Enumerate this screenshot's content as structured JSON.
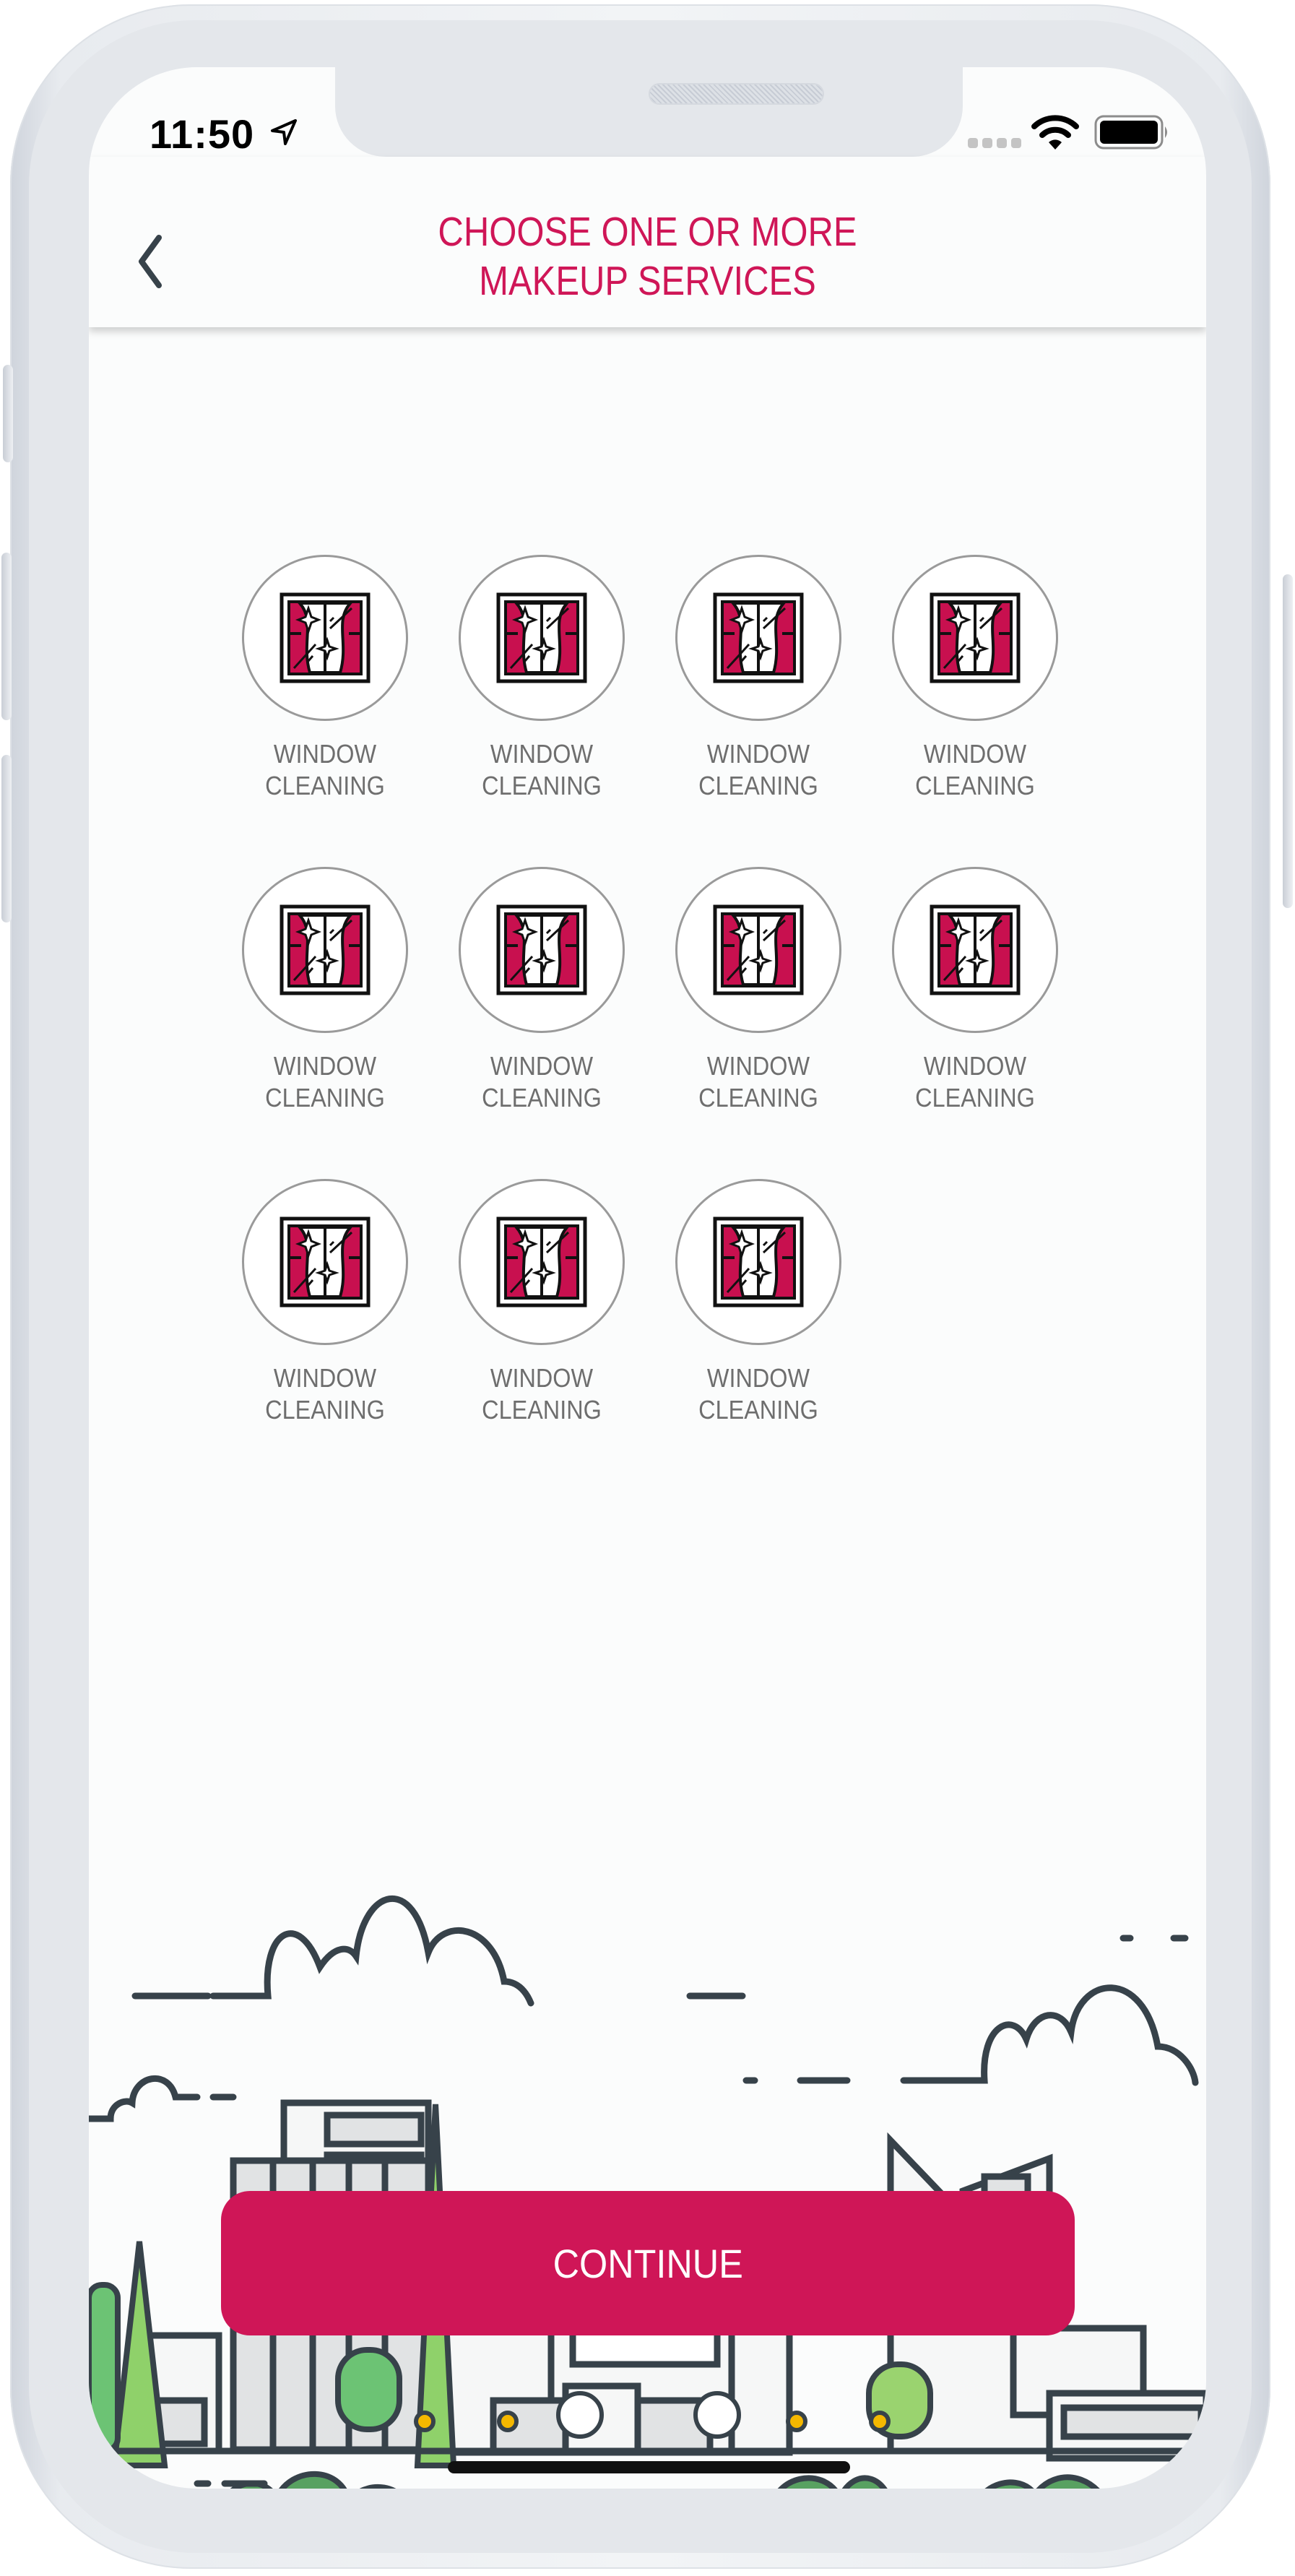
{
  "status_bar": {
    "time": "11:50",
    "icons": [
      "location-arrow-icon",
      "cellular-signal-icon",
      "wifi-icon",
      "battery-icon"
    ]
  },
  "header": {
    "back_icon": "chevron-left-icon",
    "title_line1": "CHOOSE ONE OR MORE",
    "title_line2": "MAKEUP SERVICES"
  },
  "services": [
    {
      "line1": "WINDOW",
      "line2": "CLEANING",
      "icon": "window-cleaning-icon"
    },
    {
      "line1": "WINDOW",
      "line2": "CLEANING",
      "icon": "window-cleaning-icon"
    },
    {
      "line1": "WINDOW",
      "line2": "CLEANING",
      "icon": "window-cleaning-icon"
    },
    {
      "line1": "WINDOW",
      "line2": "CLEANING",
      "icon": "window-cleaning-icon"
    },
    {
      "line1": "WINDOW",
      "line2": "CLEANING",
      "icon": "window-cleaning-icon"
    },
    {
      "line1": "WINDOW",
      "line2": "CLEANING",
      "icon": "window-cleaning-icon"
    },
    {
      "line1": "WINDOW",
      "line2": "CLEANING",
      "icon": "window-cleaning-icon"
    },
    {
      "line1": "WINDOW",
      "line2": "CLEANING",
      "icon": "window-cleaning-icon"
    },
    {
      "line1": "WINDOW",
      "line2": "CLEANING",
      "icon": "window-cleaning-icon"
    },
    {
      "line1": "WINDOW",
      "line2": "CLEANING",
      "icon": "window-cleaning-icon"
    },
    {
      "line1": "WINDOW",
      "line2": "CLEANING",
      "icon": "window-cleaning-icon"
    }
  ],
  "continue_button": {
    "label": "CONTINUE"
  },
  "colors": {
    "accent": "#CF1657",
    "label_gray": "#6E6E6E",
    "circle_border": "#9A9A9A",
    "illustration_stroke": "#37424A",
    "tree_green": "#8FD16A",
    "bush_green": "#58A161",
    "lamp_yellow": "#F5B800"
  }
}
